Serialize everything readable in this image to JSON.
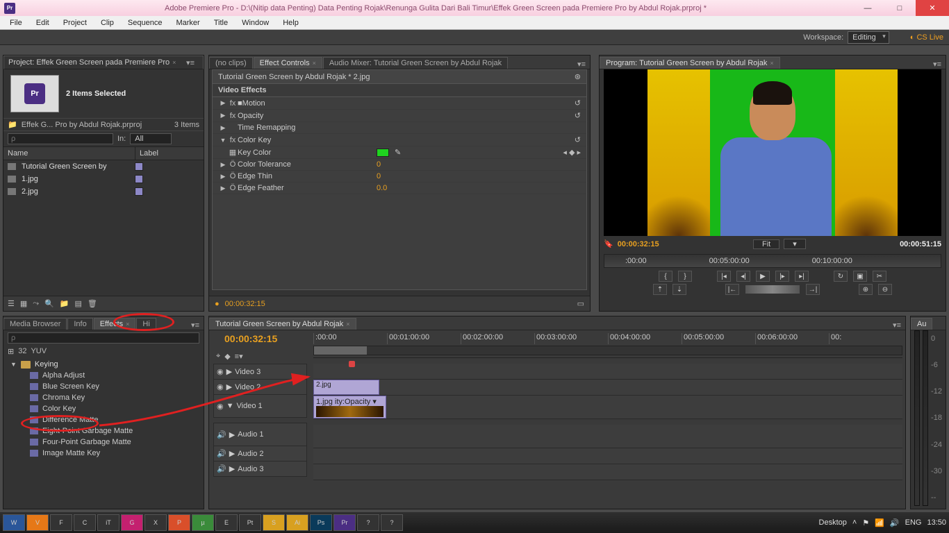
{
  "app": {
    "title": "Adobe Premiere Pro - D:\\(Nitip data Penting) Data Penting Rojak\\Renunga Gulita Dari Bali Timur\\Effek Green Screen pada Premiere Pro by Abdul Rojak.prproj *"
  },
  "menu": [
    "File",
    "Edit",
    "Project",
    "Clip",
    "Sequence",
    "Marker",
    "Title",
    "Window",
    "Help"
  ],
  "workspace": {
    "label": "Workspace:",
    "value": "Editing",
    "cslive": "CS Live"
  },
  "project": {
    "tab": "Project: Effek Green Screen pada Premiere Pro",
    "sel": "2 Items Selected",
    "file": "Effek G... Pro by Abdul Rojak.prproj",
    "count": "3 Items",
    "in_label": "In:",
    "in_value": "All",
    "cols": [
      "Name",
      "Label"
    ],
    "rows": [
      "Tutorial Green Screen by",
      "1.jpg",
      "2.jpg"
    ]
  },
  "source_tabs": {
    "noclips": "(no clips)",
    "ec": "Effect Controls",
    "am": "Audio Mixer: Tutorial Green Screen by Abdul Rojak"
  },
  "ec": {
    "title": "Tutorial Green Screen by Abdul Rojak * 2.jpg",
    "section": "Video Effects",
    "fx": [
      "Motion",
      "Opacity",
      "Time Remapping",
      "Color Key"
    ],
    "params": [
      {
        "n": "Key Color",
        "v": ""
      },
      {
        "n": "Color Tolerance",
        "v": "0"
      },
      {
        "n": "Edge Thin",
        "v": "0"
      },
      {
        "n": "Edge Feather",
        "v": "0.0"
      }
    ],
    "tc": "00:00:32:15"
  },
  "program": {
    "tab": "Program: Tutorial Green Screen by Abdul Rojak",
    "tc": "00:00:32:15",
    "fit": "Fit",
    "dur": "00:00:51:15",
    "ruler": [
      ":00:00",
      "00:05:00:00",
      "00:10:00:00"
    ]
  },
  "fx": {
    "tabs": [
      "Media Browser",
      "Info",
      "Effects",
      "Hi"
    ],
    "folder": "Keying",
    "items": [
      "Alpha Adjust",
      "Blue Screen Key",
      "Chroma Key",
      "Color Key",
      "Difference Matte",
      "Eight-Point Garbage Matte",
      "Four-Point Garbage Matte",
      "Image Matte Key"
    ]
  },
  "timeline": {
    "tab": "Tutorial Green Screen by Abdul Rojak",
    "tc": "00:00:32:15",
    "ticks": [
      ":00:00",
      "00:01:00:00",
      "00:02:00:00",
      "00:03:00:00",
      "00:04:00:00",
      "00:05:00:00",
      "00:06:00:00",
      "00:"
    ],
    "tracks": [
      "Video 3",
      "Video 2",
      "Video 1",
      "Audio 1",
      "Audio 2",
      "Audio 3"
    ],
    "clips": {
      "v2": "2.jpg",
      "v1": "1.jpg ity:Opacity ▾"
    }
  },
  "meters": {
    "tab": "Au",
    "scale": [
      "0",
      "-6",
      "-12",
      "-18",
      "-24",
      "-30",
      "--"
    ]
  },
  "taskbar": {
    "apps": [
      "W",
      "V",
      "F",
      "C",
      "iT",
      "G",
      "X",
      "P",
      "µ",
      "E",
      "Pt",
      "S",
      "Ai",
      "Ps",
      "Pr",
      "?",
      "?"
    ],
    "desktop": "Desktop",
    "lang": "ENG",
    "time": "13:50"
  },
  "search_placeholder": "ρ"
}
